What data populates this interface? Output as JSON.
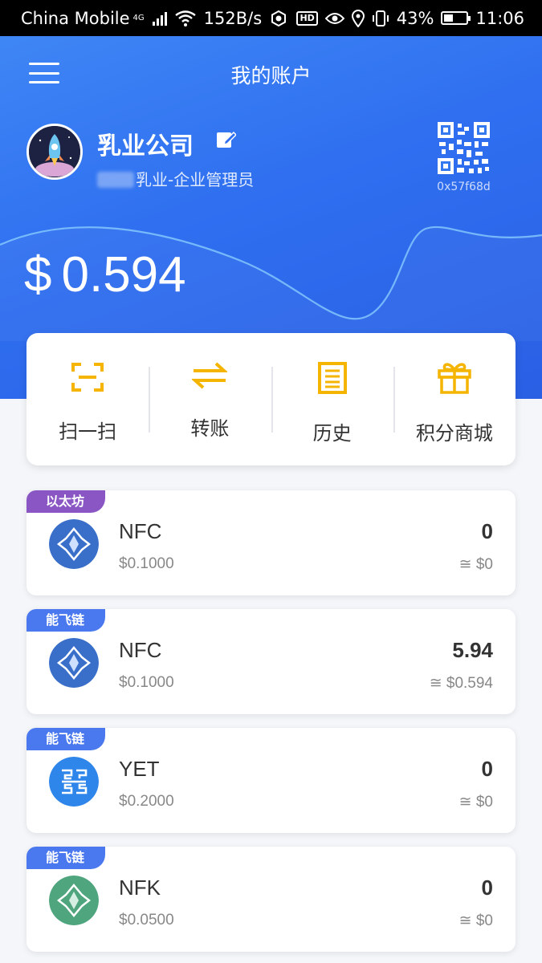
{
  "status_bar": {
    "carrier": "China Mobile",
    "network": "4G",
    "speed": "152B/s",
    "hd": "HD",
    "battery": "43%",
    "time": "11:06"
  },
  "header": {
    "title": "我的账户"
  },
  "account": {
    "company": "乳业公司",
    "role": "乳业-企业管理员",
    "address": "0x57f68d",
    "balance_currency": "$",
    "balance": "0.594"
  },
  "actions": [
    {
      "label": "扫一扫",
      "icon": "scan-icon"
    },
    {
      "label": "转账",
      "icon": "transfer-icon"
    },
    {
      "label": "历史",
      "icon": "history-icon"
    },
    {
      "label": "积分商城",
      "icon": "gift-icon"
    }
  ],
  "tokens": [
    {
      "chain": "以太坊",
      "chain_color": "#8a56c4",
      "symbol": "NFC",
      "price": "$0.1000",
      "amount": "0",
      "value": "≅ $0",
      "icon": "nfc-coin-icon"
    },
    {
      "chain": "能飞链",
      "chain_color": "#4a78ee",
      "symbol": "NFC",
      "price": "$0.1000",
      "amount": "5.94",
      "value": "≅ $0.594",
      "icon": "nfc-coin-icon"
    },
    {
      "chain": "能飞链",
      "chain_color": "#4a78ee",
      "symbol": "YET",
      "price": "$0.2000",
      "amount": "0",
      "value": "≅ $0",
      "icon": "yet-coin-icon"
    },
    {
      "chain": "能飞链",
      "chain_color": "#4a78ee",
      "symbol": "NFK",
      "price": "$0.0500",
      "amount": "0",
      "value": "≅ $0",
      "icon": "nfk-coin-icon"
    }
  ],
  "colors": {
    "primary": "#3377f0",
    "action_icon": "#f4b400",
    "nfc_coin": "#3a6fc9",
    "yet_coin": "#2f86ea",
    "nfk_coin": "#4fa57d"
  }
}
